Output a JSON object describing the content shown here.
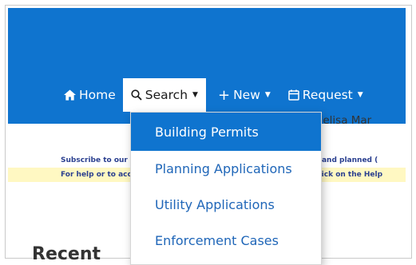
{
  "nav": {
    "home_label": "Home",
    "search_label": "Search",
    "new_label": "New",
    "request_label": "Request"
  },
  "user": {
    "signed_in_text": "n as:Melisa Mar"
  },
  "notices": {
    "subscribe_left": "Subscribe to our",
    "subscribe_right": "ates and planned (",
    "help_left": "For help or to acc",
    "help_right": "e click on the Help"
  },
  "dropdown": {
    "items": [
      "Building Permits",
      "Planning Applications",
      "Utility Applications",
      "Enforcement Cases"
    ]
  },
  "section": {
    "recent_partial": "Recent"
  },
  "colors": {
    "primary_blue": "#0f74cf",
    "link_blue": "#1f66b8",
    "highlight": "#fff8c2"
  }
}
